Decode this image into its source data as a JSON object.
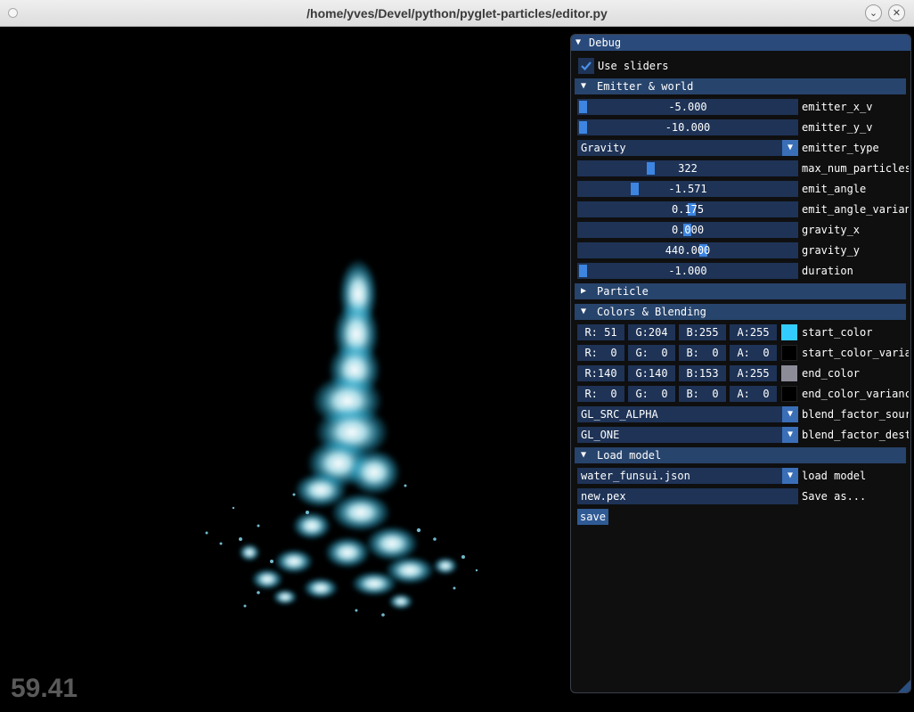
{
  "window": {
    "title": "/home/yves/Devel/python/pyglet-particles/editor.py"
  },
  "fps": "59.41",
  "panel": {
    "title": "Debug",
    "use_sliders_label": "Use sliders",
    "use_sliders_checked": true,
    "sections": {
      "emitter_world": "Emitter & world",
      "particle": "Particle",
      "colors_blending": "Colors & Blending",
      "load_model": "Load model"
    },
    "emitter": {
      "emitter_x_v": {
        "value": "-5.000",
        "label": "emitter_x_v"
      },
      "emitter_y_v": {
        "value": "-10.000",
        "label": "emitter_y_v"
      },
      "emitter_type": {
        "value": "Gravity",
        "label": "emitter_type"
      },
      "max_num_particles": {
        "value": "322",
        "label": "max_num_particles"
      },
      "emit_angle": {
        "value": "-1.571",
        "label": "emit_angle"
      },
      "emit_angle_variance": {
        "value": "0.175",
        "label": "emit_angle_varian"
      },
      "gravity_x": {
        "value": "0.000",
        "label": "gravity_x"
      },
      "gravity_y": {
        "value": "440.000",
        "label": "gravity_y"
      },
      "duration": {
        "value": "-1.000",
        "label": "duration"
      }
    },
    "colors": {
      "start_color": {
        "r": "R: 51",
        "g": "G:204",
        "b": "B:255",
        "a": "A:255",
        "label": "start_color",
        "swatch": "#33ccff"
      },
      "start_color_variance": {
        "r": "R:  0",
        "g": "G:  0",
        "b": "B:  0",
        "a": "A:  0",
        "label": "start_color_varia",
        "swatch": "#000000"
      },
      "end_color": {
        "r": "R:140",
        "g": "G:140",
        "b": "B:153",
        "a": "A:255",
        "label": "end_color",
        "swatch": "#8c8c99"
      },
      "end_color_variance": {
        "r": "R:  0",
        "g": "G:  0",
        "b": "B:  0",
        "a": "A:  0",
        "label": "end_color_varianc",
        "swatch": "#000000"
      },
      "blend_factor_source": {
        "value": "GL_SRC_ALPHA",
        "label": "blend_factor_sour"
      },
      "blend_factor_dest": {
        "value": "GL_ONE",
        "label": "blend_factor_dest"
      }
    },
    "model": {
      "load_model": {
        "value": "water_funsui.json",
        "label": "load model"
      },
      "save_as": {
        "value": "new.pex",
        "label": "Save as..."
      },
      "save_button": "save"
    }
  },
  "colors": {
    "accent": "#3d85e0",
    "frame_bg": "#1e3356",
    "header_bg": "#27446c",
    "particle": "#7fe8ff"
  }
}
